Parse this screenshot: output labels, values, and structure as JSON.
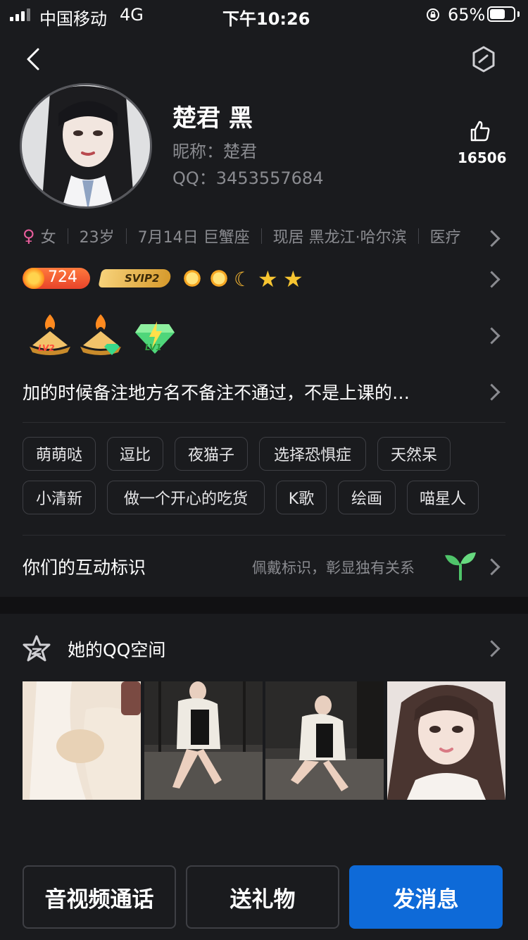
{
  "status_bar": {
    "carrier": "中国移动",
    "network": "4G",
    "time": "下午10:26",
    "battery": "65%",
    "battery_level": 0.65
  },
  "profile": {
    "name": "楚君 黑",
    "nickname": "昵称：楚君",
    "qq": "QQ：3453557684",
    "like_count": "16506"
  },
  "info": {
    "gender": "女",
    "age": "23岁",
    "birthday": "7月14日 巨蟹座",
    "location": "现居 黑龙江·哈尔滨",
    "profession": "医疗"
  },
  "badges": {
    "level": "724",
    "svip": "SVIP2",
    "medal_labels": [
      "LV2",
      "LV1"
    ]
  },
  "bio": "加的时候备注地方名不备注不通过，不是上课的…",
  "tags": [
    "萌萌哒",
    "逗比",
    "夜猫子",
    "选择恐惧症",
    "天然呆",
    "小清新",
    "做一个开心的吃货",
    "K歌",
    "绘画",
    "喵星人"
  ],
  "interaction": {
    "label": "你们的互动标识",
    "hint": "佩戴标识，彰显独有关系"
  },
  "qzone": {
    "label": "她的QQ空间"
  },
  "buttons": {
    "call": "音视频通话",
    "gift": "送礼物",
    "message": "发消息"
  },
  "colors": {
    "background": "#1a1b1e",
    "primary_button": "#0e6ad8",
    "gender_pink": "#e85d9c",
    "secondary_text": "#8a8b90"
  }
}
